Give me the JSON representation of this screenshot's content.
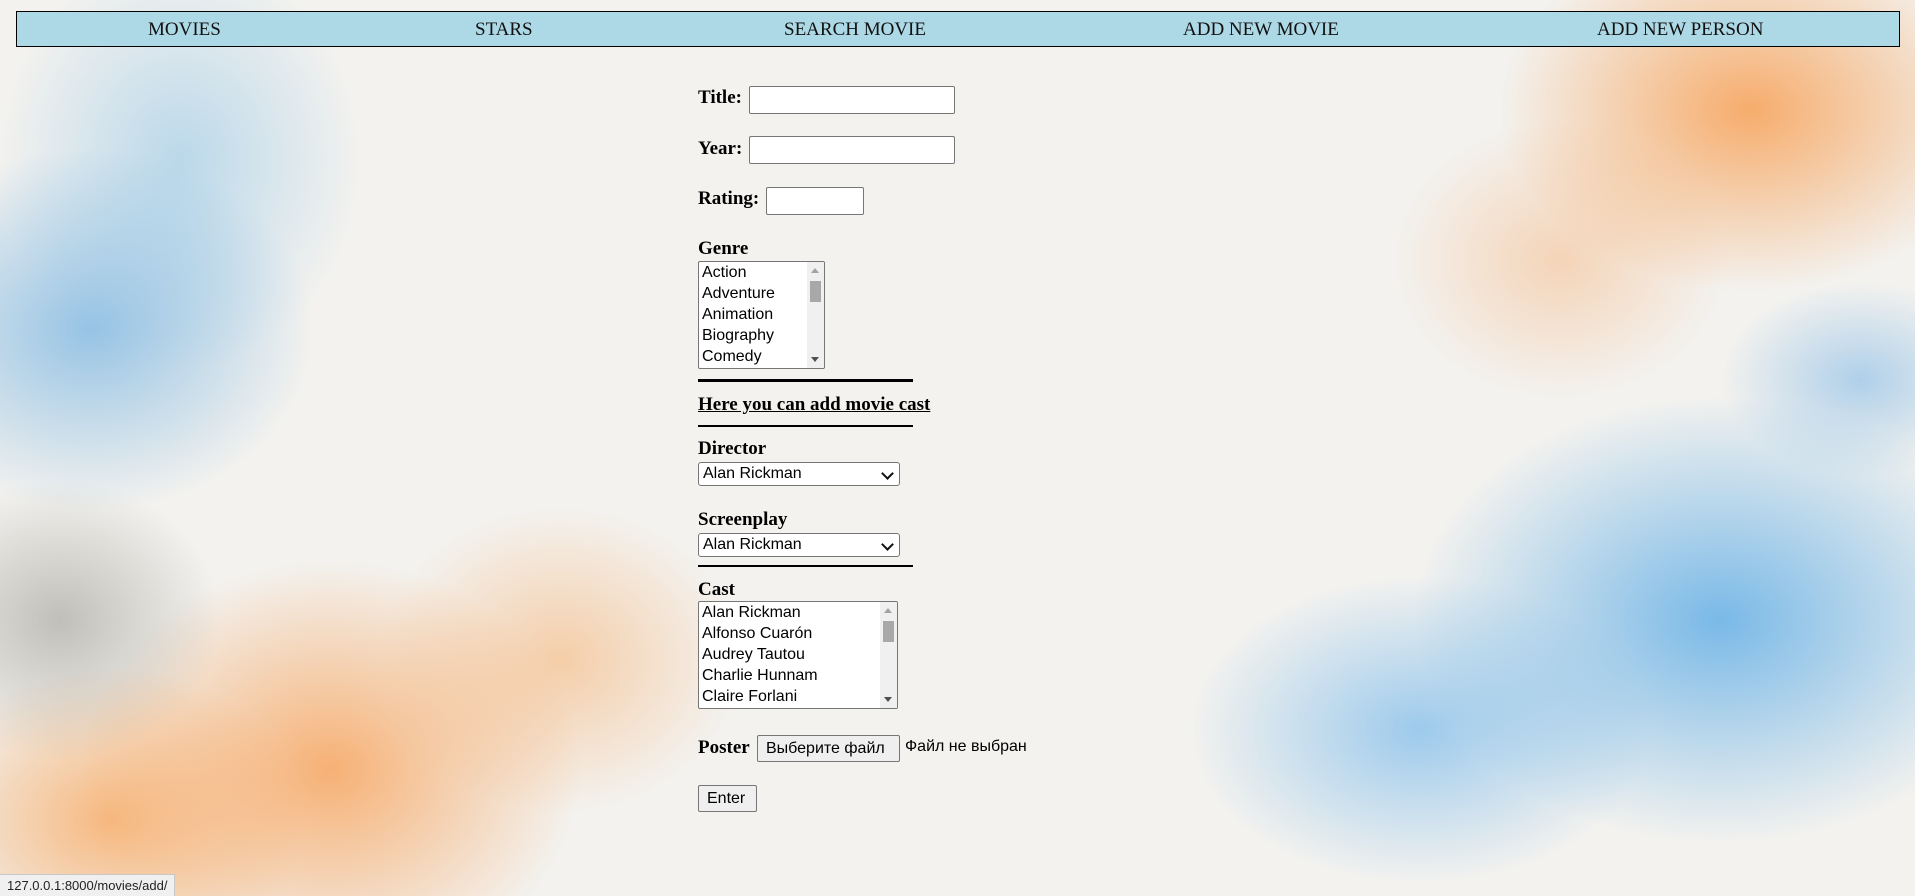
{
  "nav": {
    "items": [
      "MOVIES",
      "STARS",
      "SEARCH MOVIE",
      "ADD NEW MOVIE",
      "ADD NEW PERSON"
    ]
  },
  "form": {
    "title_label": "Title:",
    "title_value": "",
    "year_label": "Year:",
    "year_value": "",
    "rating_label": "Rating:",
    "rating_value": "",
    "genre_label": "Genre",
    "genre_options": [
      "Action",
      "Adventure",
      "Animation",
      "Biography",
      "Comedy"
    ],
    "cast_link": "Here you can add movie cast",
    "director_label": "Director",
    "director_value": "Alan Rickman",
    "screenplay_label": "Screenplay",
    "screenplay_value": "Alan Rickman",
    "cast_label": "Cast",
    "cast_options": [
      "Alan Rickman",
      "Alfonso Cuarón",
      "Audrey Tautou",
      "Charlie Hunnam",
      "Claire Forlani"
    ],
    "poster_label": "Poster",
    "file_button": "Выберите файл",
    "file_status": "Файл не выбран",
    "enter_button": "Enter"
  },
  "status_bar": {
    "url": "127.0.0.1:8000/movies/add/"
  }
}
